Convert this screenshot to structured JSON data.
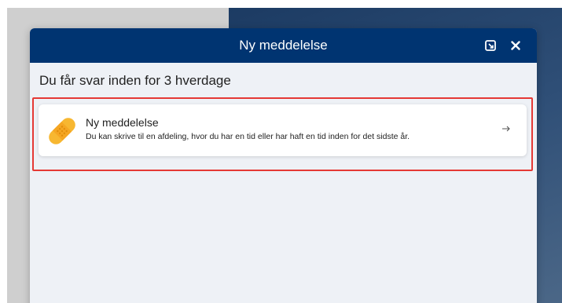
{
  "dialog": {
    "title": "Ny meddelelse",
    "expand_icon": "expand-icon",
    "close_icon": "close-icon"
  },
  "subtitle": "Du får svar inden for 3 hverdage",
  "option": {
    "title": "Ny meddelelse",
    "description": "Du kan skrive til en afdeling, hvor du har en tid eller har haft en tid inden for det sidste år.",
    "icon": "bandage-icon",
    "arrow_icon": "arrow-right-icon"
  },
  "colors": {
    "titlebar": "#003471",
    "highlight": "#e53935",
    "icon_yellow": "#f7b731"
  }
}
